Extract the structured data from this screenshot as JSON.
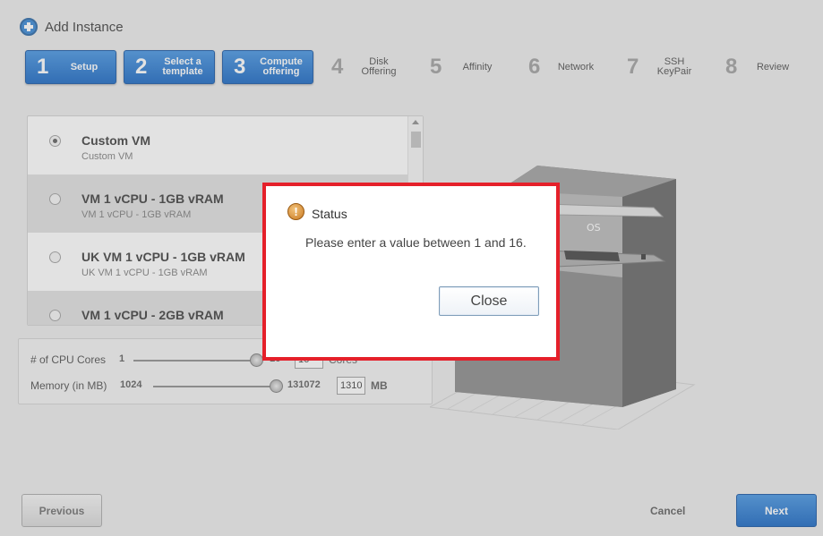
{
  "header": {
    "title": "Add Instance"
  },
  "steps": [
    {
      "num": "1",
      "label": "Setup",
      "active": true
    },
    {
      "num": "2",
      "label": "Select a template",
      "active": true
    },
    {
      "num": "3",
      "label": "Compute offering",
      "active": true
    },
    {
      "num": "4",
      "label": "Disk Offering",
      "active": false
    },
    {
      "num": "5",
      "label": "Affinity",
      "active": false
    },
    {
      "num": "6",
      "label": "Network",
      "active": false
    },
    {
      "num": "7",
      "label": "SSH KeyPair",
      "active": false
    },
    {
      "num": "8",
      "label": "Review",
      "active": false
    }
  ],
  "offerings": [
    {
      "name": "Custom VM",
      "desc": "Custom VM",
      "selected": true
    },
    {
      "name": "VM 1 vCPU - 1GB vRAM",
      "desc": "VM 1 vCPU - 1GB vRAM",
      "selected": false
    },
    {
      "name": "UK VM 1 vCPU - 1GB vRAM",
      "desc": "UK VM 1 vCPU - 1GB vRAM",
      "selected": false
    },
    {
      "name": "VM 1 vCPU - 2GB vRAM",
      "desc": "",
      "selected": false
    }
  ],
  "cpu": {
    "label": "# of CPU Cores",
    "min": "1",
    "max": "16",
    "value": "16",
    "unit": "Cores"
  },
  "memory": {
    "label": "Memory (in MB)",
    "min": "1024",
    "max": "131072",
    "value": "1310",
    "unit": "MB"
  },
  "server_image": {
    "os_label": "OS"
  },
  "buttons": {
    "previous": "Previous",
    "cancel": "Cancel",
    "next": "Next"
  },
  "dialog": {
    "title": "Status",
    "message": "Please enter a value between 1 and 16.",
    "close": "Close",
    "icon_glyph": "!"
  }
}
